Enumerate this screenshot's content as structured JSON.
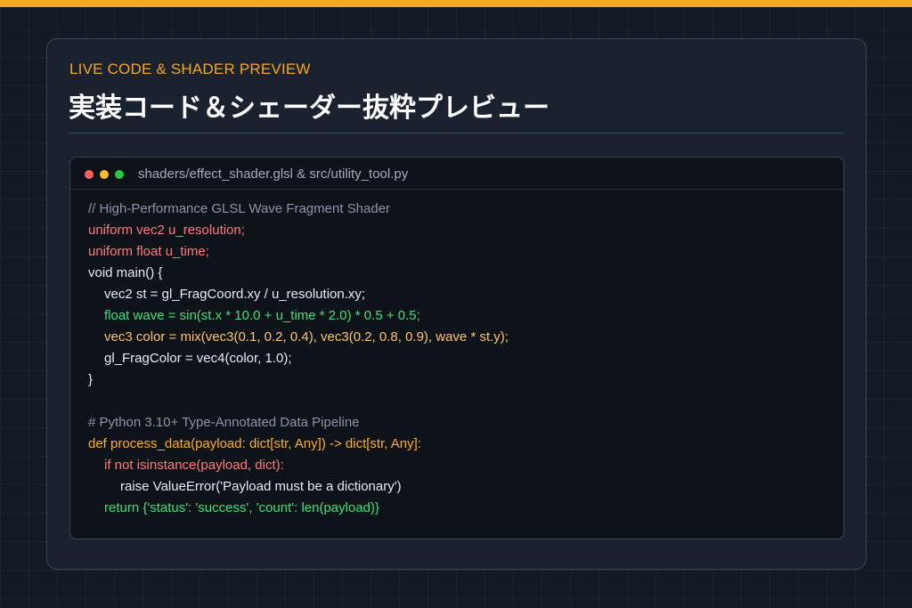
{
  "header": {
    "kicker": "LIVE CODE & SHADER PREVIEW",
    "title": "実装コード＆シェーダー抜粋プレビュー"
  },
  "editor": {
    "window_controls": [
      "close",
      "minimize",
      "maximize"
    ],
    "file_path": "shaders/effect_shader.glsl & src/utility_tool.py",
    "lines": [
      {
        "text": "// High-Performance GLSL Wave Fragment Shader",
        "style": "comment",
        "indent": 0
      },
      {
        "text": "uniform vec2 u_resolution;",
        "style": "red",
        "indent": 0
      },
      {
        "text": "uniform float u_time;",
        "style": "red",
        "indent": 0
      },
      {
        "text": "void main() {",
        "style": "white",
        "indent": 0
      },
      {
        "text": "vec2 st = gl_FragCoord.xy / u_resolution.xy;",
        "style": "white",
        "indent": 1
      },
      {
        "text": "float wave = sin(st.x * 10.0 + u_time * 2.0) * 0.5 + 0.5;",
        "style": "green",
        "indent": 1
      },
      {
        "text": "vec3 color = mix(vec3(0.1, 0.2, 0.4), vec3(0.2, 0.8, 0.9), wave * st.y);",
        "style": "orange",
        "indent": 1
      },
      {
        "text": "gl_FragColor = vec4(color, 1.0);",
        "style": "white",
        "indent": 1
      },
      {
        "text": "}",
        "style": "white",
        "indent": 0
      },
      {
        "text": "",
        "style": "white",
        "indent": 0
      },
      {
        "text": "# Python 3.10+ Type-Annotated Data Pipeline",
        "style": "comment",
        "indent": 0
      },
      {
        "text": "def process_data(payload: dict[str, Any]) -> dict[str, Any]:",
        "style": "amber",
        "indent": 0
      },
      {
        "text": "if not isinstance(payload, dict):",
        "style": "red",
        "indent": 1
      },
      {
        "text": "raise ValueError('Payload must be a dictionary')",
        "style": "white",
        "indent": 2
      },
      {
        "text": "return {'status': 'success', 'count': len(payload)}",
        "style": "green",
        "indent": 1
      }
    ]
  },
  "colors": {
    "accent": "#f5a623",
    "background": "#141a24",
    "card": "#1a2230",
    "editor": "#0e1219",
    "comment": "#8a96a8",
    "keyword_red": "#ff7a7a",
    "string_green": "#3ee07a",
    "number_orange": "#ffc470",
    "def_amber": "#ffb020"
  }
}
